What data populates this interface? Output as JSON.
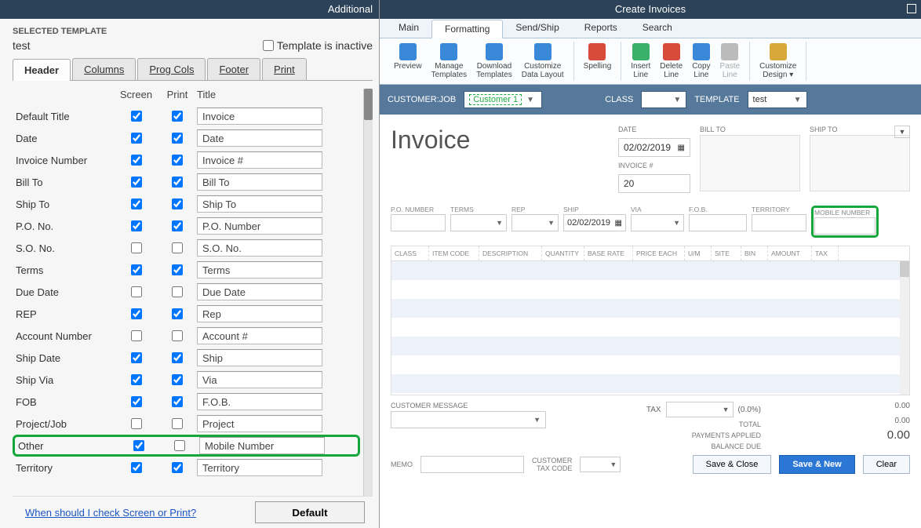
{
  "left": {
    "title": "Additional",
    "selected_label": "SELECTED TEMPLATE",
    "selected_name": "test",
    "inactive_label": "Template is inactive",
    "tabs": [
      "Header",
      "Columns",
      "Prog Cols",
      "Footer",
      "Print"
    ],
    "cols": {
      "screen": "Screen",
      "print": "Print",
      "title": "Title"
    },
    "rows": [
      {
        "label": "Default Title",
        "screen": true,
        "print": true,
        "title": "Invoice"
      },
      {
        "label": "Date",
        "screen": true,
        "print": true,
        "title": "Date"
      },
      {
        "label": "Invoice Number",
        "screen": true,
        "print": true,
        "title": "Invoice #"
      },
      {
        "label": "Bill To",
        "screen": true,
        "print": true,
        "title": "Bill To"
      },
      {
        "label": "Ship To",
        "screen": true,
        "print": true,
        "title": "Ship To"
      },
      {
        "label": "P.O. No.",
        "screen": true,
        "print": true,
        "title": "P.O. Number"
      },
      {
        "label": "S.O. No.",
        "screen": false,
        "print": false,
        "title": "S.O. No."
      },
      {
        "label": "Terms",
        "screen": true,
        "print": true,
        "title": "Terms"
      },
      {
        "label": "Due Date",
        "screen": false,
        "print": false,
        "title": "Due Date"
      },
      {
        "label": "REP",
        "screen": true,
        "print": true,
        "title": "Rep"
      },
      {
        "label": "Account Number",
        "screen": false,
        "print": false,
        "title": "Account #"
      },
      {
        "label": "Ship Date",
        "screen": true,
        "print": true,
        "title": "Ship"
      },
      {
        "label": "Ship Via",
        "screen": true,
        "print": true,
        "title": "Via"
      },
      {
        "label": "FOB",
        "screen": true,
        "print": true,
        "title": "F.O.B."
      },
      {
        "label": "Project/Job",
        "screen": false,
        "print": false,
        "title": "Project"
      },
      {
        "label": "Other",
        "screen": true,
        "print": false,
        "title": "Mobile Number",
        "highlight": true
      },
      {
        "label": "Territory",
        "screen": true,
        "print": true,
        "title": "Territory"
      }
    ],
    "help_link": "When should I check Screen or Print?",
    "default_btn": "Default"
  },
  "right": {
    "title": "Create Invoices",
    "tabs": [
      "Main",
      "Formatting",
      "Send/Ship",
      "Reports",
      "Search"
    ],
    "active_tab": "Formatting",
    "ribbon": [
      {
        "label": "Preview",
        "icon": "preview-icon"
      },
      {
        "label": "Manage\nTemplates",
        "icon": "manage-icon"
      },
      {
        "label": "Download\nTemplates",
        "icon": "download-icon"
      },
      {
        "label": "Customize\nData Layout",
        "icon": "layout-icon"
      },
      {
        "sep": true
      },
      {
        "label": "Spelling",
        "icon": "spelling-icon"
      },
      {
        "sep": true
      },
      {
        "label": "Insert\nLine",
        "icon": "insert-line-icon"
      },
      {
        "label": "Delete\nLine",
        "icon": "delete-line-icon"
      },
      {
        "label": "Copy\nLine",
        "icon": "copy-line-icon"
      },
      {
        "label": "Paste\nLine",
        "icon": "paste-line-icon",
        "disabled": true
      },
      {
        "sep": true
      },
      {
        "label": "Customize\nDesign ▾",
        "icon": "design-icon"
      }
    ],
    "bar": {
      "customer_lbl": "CUSTOMER:JOB",
      "customer_val": "Customer 1",
      "class_lbl": "CLASS",
      "template_lbl": "TEMPLATE",
      "template_val": "test"
    },
    "inv": {
      "title": "Invoice",
      "date_lbl": "DATE",
      "date_val": "02/02/2019",
      "num_lbl": "INVOICE #",
      "num_val": "20",
      "bill_lbl": "BILL TO",
      "ship_lbl": "SHIP TO"
    },
    "fields": [
      {
        "label": "P.O. NUMBER",
        "w": 70
      },
      {
        "label": "TERMS",
        "w": 72,
        "dd": true
      },
      {
        "label": "REP",
        "w": 60,
        "dd": true
      },
      {
        "label": "SHIP",
        "w": 80,
        "val": "02/02/2019",
        "cal": true
      },
      {
        "label": "VIA",
        "w": 68,
        "dd": true
      },
      {
        "label": "F.O.B.",
        "w": 74
      },
      {
        "label": "TERRITORY",
        "w": 70
      },
      {
        "label": "MOBILE NUMBER",
        "w": 86,
        "highlight": true
      }
    ],
    "grid_cols": [
      "CLASS",
      "ITEM CODE",
      "DESCRIPTION",
      "QUANTITY",
      "BASE RATE",
      "PRICE EACH",
      "U/M",
      "SITE",
      "BIN",
      "AMOUNT",
      "TAX"
    ],
    "totals": {
      "cust_msg": "CUSTOMER MESSAGE",
      "tax_lbl": "TAX",
      "tax_pct": "(0.0%)",
      "tax_amt": "0.00",
      "total_lbl": "TOTAL",
      "pay_lbl": "PAYMENTS APPLIED",
      "pay_amt": "0.00",
      "bal_lbl": "BALANCE DUE",
      "bal_amt": "0.00"
    },
    "memo": {
      "lbl": "MEMO",
      "ctc": "CUSTOMER\nTAX CODE"
    },
    "buttons": {
      "save_close": "Save & Close",
      "save_new": "Save & New",
      "clear": "Clear"
    }
  }
}
